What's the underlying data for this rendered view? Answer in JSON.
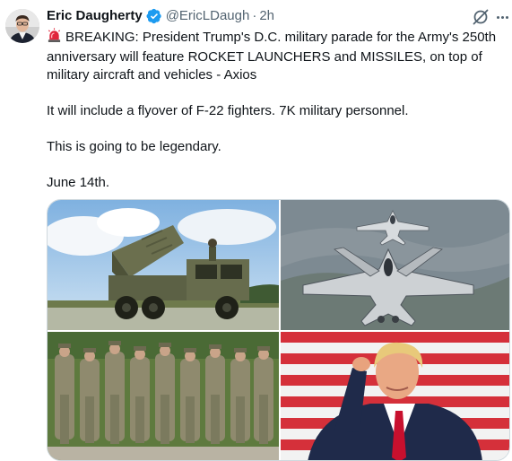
{
  "author": {
    "name": "Eric Daugherty",
    "handle": "@EricLDaugh",
    "separator": "·",
    "time": "2h"
  },
  "tweet": {
    "line1": "BREAKING: President Trump's D.C. military parade for the Army's 250th anniversary will feature ROCKET LAUNCHERS and MISSILES, on top of military aircraft and vehicles - Axios",
    "line2": "It will include a flyover of F-22 fighters. 7K military personnel.",
    "line3": "This is going to be legendary.",
    "line4": "June 14th."
  },
  "icons": {
    "verified": "verified-badge-icon",
    "grok": "grok-icon",
    "more": "more-options-icon",
    "siren": "siren-emoji-icon"
  },
  "colors": {
    "text": "#0f1419",
    "secondary": "#536471",
    "verified": "#1d9bf0",
    "border": "#cfd9de"
  }
}
